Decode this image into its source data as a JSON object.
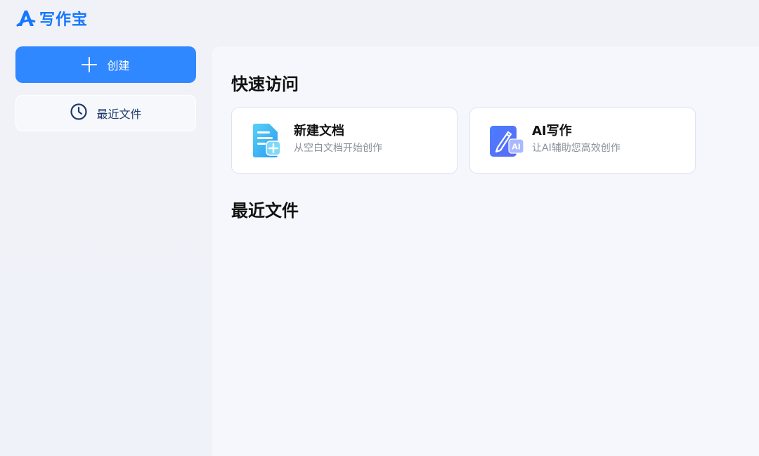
{
  "app": {
    "logo_text": "写作宝",
    "accent_color": "#2f88ff"
  },
  "sidebar": {
    "create_label": "创建",
    "create_icon": "plus-icon",
    "recent_label": "最近文件",
    "recent_icon": "clock-icon"
  },
  "main": {
    "quick_access_title": "快速访问",
    "cards": [
      {
        "title": "新建文档",
        "subtitle": "从空白文档开始创作",
        "icon": "new-document-icon"
      },
      {
        "title": "AI写作",
        "subtitle": "让AI辅助您高效创作",
        "icon": "ai-pen-icon"
      }
    ],
    "recent_files_title": "最近文件"
  }
}
